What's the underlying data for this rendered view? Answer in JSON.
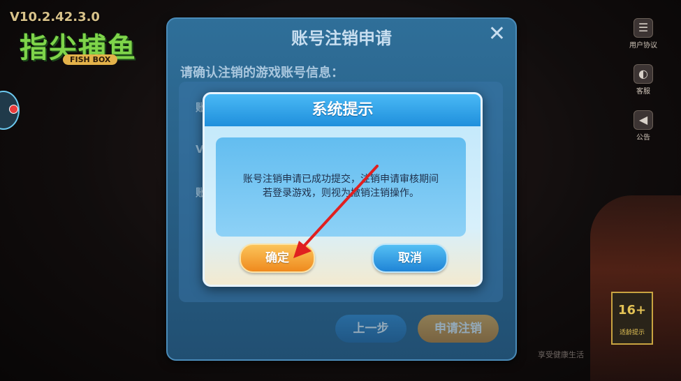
{
  "background": {
    "version": "V10.2.42.3.0",
    "logo_text": "指尖捕鱼",
    "logo_sub": "FISH BOX",
    "right_buttons": [
      {
        "label": "用户协议",
        "icon": "document-icon"
      },
      {
        "label": "客服",
        "icon": "headset-icon"
      },
      {
        "label": "公告",
        "icon": "megaphone-icon"
      }
    ],
    "age_rating": {
      "number": "16+",
      "label": "适龄提示"
    },
    "footer_note": "享受健康生活"
  },
  "panel": {
    "title": "账号注销申请",
    "close_icon": "close-icon",
    "prompt": "请确认注销的游戏账号信息：",
    "rows": [
      "账",
      "VIP",
      "账"
    ],
    "prev_button": "上一步",
    "apply_button": "申请注销"
  },
  "dialog": {
    "title": "系统提示",
    "message_line1": "账号注销申请已成功提交，注销申请审核期间",
    "message_line2": "若登录游戏，则视为撤销注销操作。",
    "confirm_button": "确定",
    "cancel_button": "取消"
  },
  "colors": {
    "dialog_header": "#1f8fdc",
    "confirm": "#ef8a1e",
    "cancel": "#1f84d6",
    "annotation_arrow": "#e02020"
  }
}
